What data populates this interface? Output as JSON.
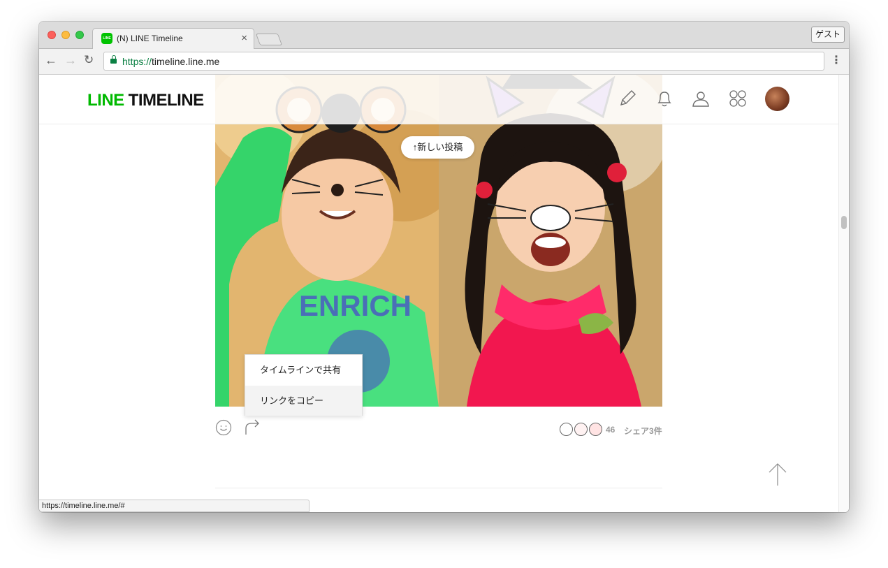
{
  "browser": {
    "tab_title": "(N) LINE Timeline",
    "tab_favicon_text": "LINE",
    "tab_close": "×",
    "guest_label": "ゲスト",
    "url_scheme": "https://",
    "url_host": "timeline.line.me",
    "status_url": "https://timeline.line.me/#"
  },
  "site": {
    "logo_line": "LINE",
    "logo_timeline": "TIMELINE",
    "header_icons": [
      "pencil-icon",
      "bell-icon",
      "person-icon",
      "apps-grid-icon"
    ]
  },
  "feed": {
    "new_posts_label": "↑新しい投稿",
    "share_menu": {
      "share_to_timeline": "タイムラインで共有",
      "copy_link": "リンクをコピー"
    },
    "reaction_count": "46",
    "share_count_label": "シェア3件"
  },
  "colors": {
    "brand_green": "#00b900",
    "secure_green": "#0b8043"
  }
}
